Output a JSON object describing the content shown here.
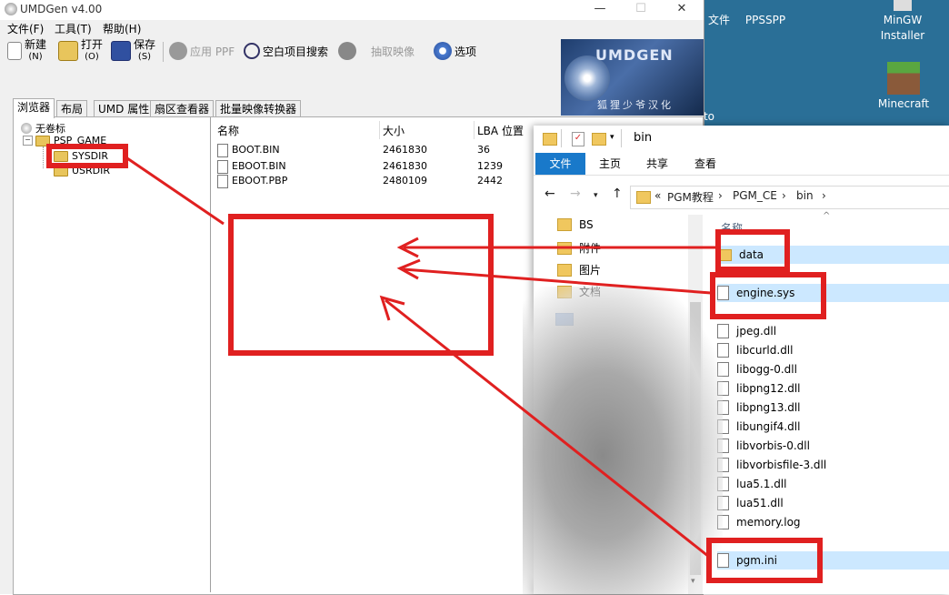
{
  "desktop": {
    "icons": [
      {
        "label": "文件",
        "name": "desktop-file-icon"
      },
      {
        "label": "PPSSPP",
        "name": "ppsspp-icon"
      },
      {
        "label": "MinGW Installer",
        "name": "mingw-icon"
      },
      {
        "label": "to",
        "name": "desktop-to-icon"
      },
      {
        "label": "Minecraft",
        "name": "minecraft-icon"
      }
    ],
    "background": "#2a6f97"
  },
  "umd": {
    "title": "UMDGen v4.00",
    "window_controls": [
      "—",
      "☐",
      "✕"
    ],
    "menu": [
      "文件(F)",
      "工具(T)",
      "帮助(H)"
    ],
    "toolbar": {
      "new": {
        "label": "新建",
        "key": "(N)"
      },
      "open": {
        "label": "打开",
        "key": "(O)"
      },
      "save": {
        "label": "保存",
        "key": "(S)"
      },
      "apply_ppf": "应用 PPF",
      "blank_search": "空白项目搜索",
      "extract": "抽取映像",
      "options": "选项"
    },
    "logo_text": "UMDGEN",
    "logo_subtitle": "狐狸少爷汉化",
    "tabs": [
      "浏览器",
      "布局",
      "UMD 属性",
      "扇区查看器",
      "批量映像转换器"
    ],
    "tree": {
      "root": "无卷标",
      "psp_game": "PSP_GAME",
      "sysdir": "SYSDIR",
      "usrdir": "USRDIR"
    },
    "list": {
      "headers": {
        "name": "名称",
        "size": "大小",
        "lba": "LBA 位置"
      },
      "rows": [
        {
          "name": "BOOT.BIN",
          "size": "2461830",
          "lba": "36"
        },
        {
          "name": "EBOOT.BIN",
          "size": "2461830",
          "lba": "1239"
        },
        {
          "name": "EBOOT.PBP",
          "size": "2480109",
          "lba": "2442"
        }
      ]
    }
  },
  "explorer": {
    "title": "bin",
    "ribbon_tabs": [
      "文件",
      "主页",
      "共享",
      "查看"
    ],
    "address": {
      "prefix": "«",
      "crumbs": [
        "PGM教程",
        "PGM_CE",
        "bin"
      ],
      "separator": "›"
    },
    "column_header": "名称",
    "nav_items": [
      "BS",
      "附件",
      "图片",
      "文档"
    ],
    "files": [
      {
        "name": "data",
        "type": "folder"
      },
      {
        "name": "engine.sys",
        "type": "file"
      },
      {
        "name": "jpeg.dll",
        "type": "file"
      },
      {
        "name": "libcurld.dll",
        "type": "file"
      },
      {
        "name": "libogg-0.dll",
        "type": "file"
      },
      {
        "name": "libpng12.dll",
        "type": "file"
      },
      {
        "name": "libpng13.dll",
        "type": "file"
      },
      {
        "name": "libungif4.dll",
        "type": "file"
      },
      {
        "name": "libvorbis-0.dll",
        "type": "file"
      },
      {
        "name": "libvorbisfile-3.dll",
        "type": "file"
      },
      {
        "name": "lua5.1.dll",
        "type": "file"
      },
      {
        "name": "lua51.dll",
        "type": "file"
      },
      {
        "name": "memory.log",
        "type": "file"
      },
      {
        "name": "pgm.ini",
        "type": "file"
      }
    ]
  },
  "annotation_color": "#e02020"
}
